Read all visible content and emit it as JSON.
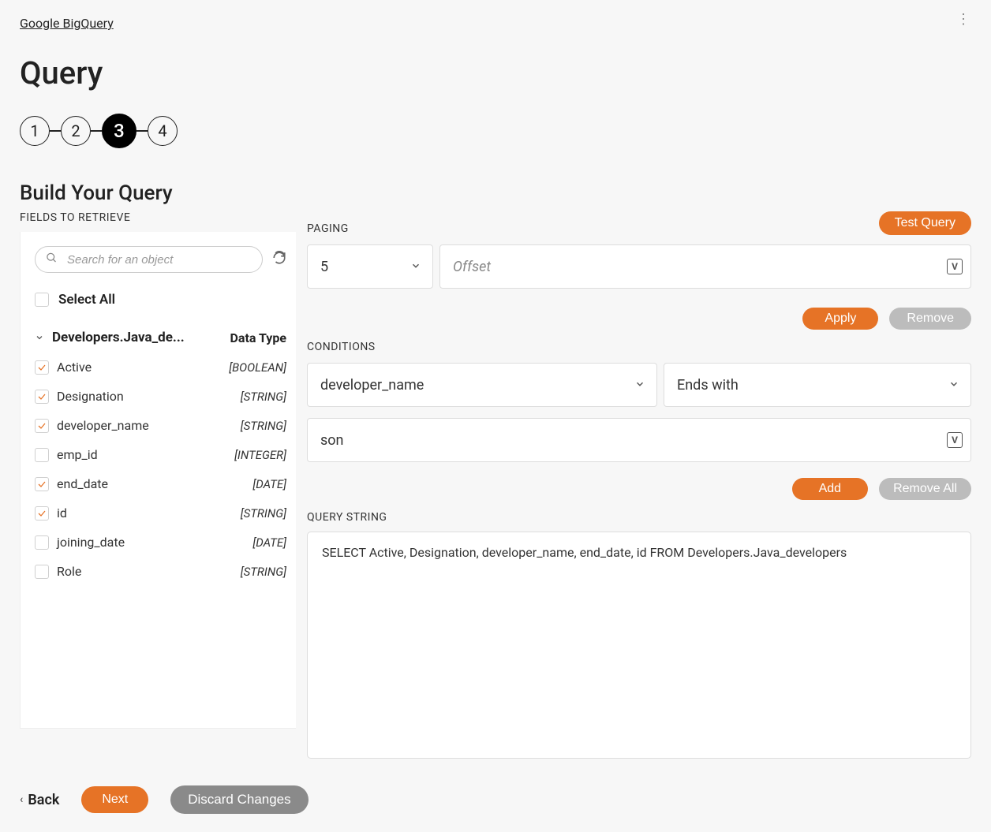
{
  "breadcrumb": "Google BigQuery",
  "page_title": "Query",
  "stepper": {
    "steps": [
      "1",
      "2",
      "3",
      "4"
    ],
    "active": 3
  },
  "section_title": "Build Your Query",
  "fields": {
    "label": "FIELDS TO RETRIEVE",
    "search_placeholder": "Search for an object",
    "select_all": "Select All",
    "tree_name": "Developers.Java_de...",
    "data_type_header": "Data Type",
    "items": [
      {
        "name": "Active",
        "type": "[BOOLEAN]",
        "checked": true
      },
      {
        "name": "Designation",
        "type": "[STRING]",
        "checked": true
      },
      {
        "name": "developer_name",
        "type": "[STRING]",
        "checked": true
      },
      {
        "name": "emp_id",
        "type": "[INTEGER]",
        "checked": false
      },
      {
        "name": "end_date",
        "type": "[DATE]",
        "checked": true
      },
      {
        "name": "id",
        "type": "[STRING]",
        "checked": true
      },
      {
        "name": "joining_date",
        "type": "[DATE]",
        "checked": false
      },
      {
        "name": "Role",
        "type": "[STRING]",
        "checked": false
      }
    ]
  },
  "paging": {
    "label": "PAGING",
    "limit": "5",
    "offset_placeholder": "Offset",
    "test_query": "Test Query",
    "apply": "Apply",
    "remove": "Remove"
  },
  "conditions": {
    "label": "CONDITIONS",
    "field": "developer_name",
    "operator": "Ends with",
    "value": "son",
    "add": "Add",
    "remove_all": "Remove All"
  },
  "query": {
    "label": "QUERY STRING",
    "value": "SELECT Active, Designation, developer_name, end_date, id FROM Developers.Java_developers"
  },
  "footer": {
    "back": "Back",
    "next": "Next",
    "discard": "Discard Changes"
  }
}
